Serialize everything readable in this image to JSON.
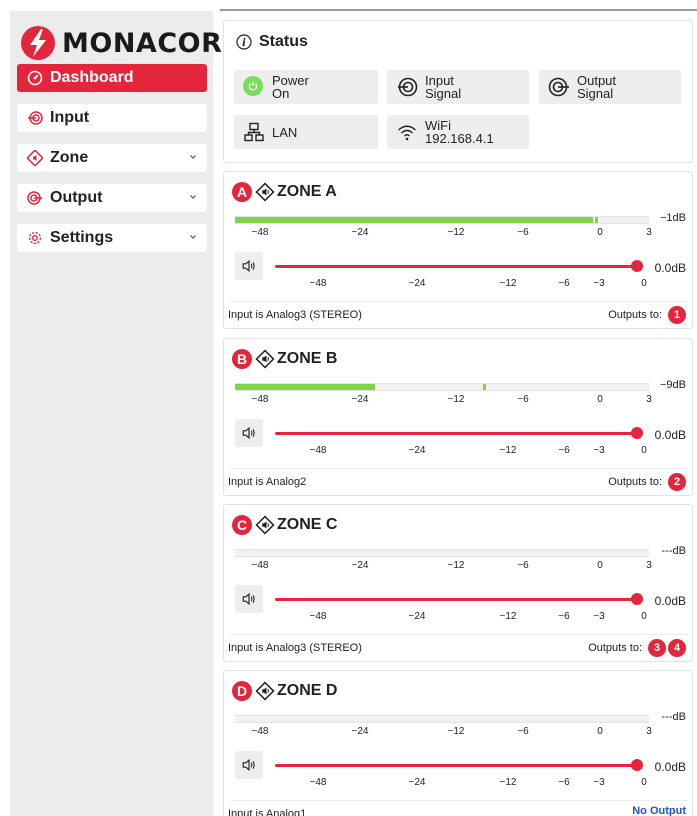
{
  "brand": {
    "name": "MONACOR",
    "accent": "#e3263b"
  },
  "top_partial_text": "",
  "nav": [
    {
      "label": "Dashboard",
      "icon": "dashboard-gauge-icon",
      "active": true,
      "has_chevron": false
    },
    {
      "label": "Input",
      "icon": "input-target-icon",
      "active": false,
      "has_chevron": false
    },
    {
      "label": "Zone",
      "icon": "zone-speaker-icon",
      "active": false,
      "has_chevron": true
    },
    {
      "label": "Output",
      "icon": "output-target-icon",
      "active": false,
      "has_chevron": true
    },
    {
      "label": "Settings",
      "icon": "gear-icon",
      "active": false,
      "has_chevron": true
    }
  ],
  "status": {
    "title": "Status",
    "tiles": [
      {
        "lines": [
          "Power",
          "On"
        ],
        "icon": "power-icon"
      },
      {
        "lines": [
          "Input",
          "Signal"
        ],
        "icon": "input-signal-icon"
      },
      {
        "lines": [
          "Output",
          "Signal"
        ],
        "icon": "output-signal-icon"
      },
      {
        "lines": [
          "LAN"
        ],
        "icon": "lan-icon"
      },
      {
        "lines": [
          "WiFi",
          "192.168.4.1"
        ],
        "icon": "wifi-icon"
      }
    ]
  },
  "meter_scale": [
    "−48",
    "−24",
    "−12",
    "−6",
    "0",
    "3"
  ],
  "volume_scale": [
    "−48",
    "−24",
    "−12",
    "−6",
    "−3",
    "0"
  ],
  "zones": [
    {
      "letter": "A",
      "title": "ZONE A",
      "meter_level": 0.95,
      "peak_level": 0.87,
      "meter_db": "−1dB",
      "volume_db": "0.0dB",
      "volume_level": 1.0,
      "input_text": "Input is Analog3 (STEREO)",
      "outputs_label": "Outputs to:",
      "outputs": [
        "1"
      ],
      "no_output_text": ""
    },
    {
      "letter": "B",
      "title": "ZONE B",
      "meter_level": 0.37,
      "peak_level": 0.6,
      "meter_db": "−9dB",
      "volume_db": "0.0dB",
      "volume_level": 1.0,
      "input_text": "Input is Analog2",
      "outputs_label": "Outputs to:",
      "outputs": [
        "2"
      ],
      "no_output_text": ""
    },
    {
      "letter": "C",
      "title": "ZONE C",
      "meter_level": 0,
      "peak_level": 0,
      "meter_db": "---dB",
      "volume_db": "0.0dB",
      "volume_level": 1.0,
      "input_text": "Input is Analog3 (STEREO)",
      "outputs_label": "Outputs to:",
      "outputs": [
        "3",
        "4"
      ],
      "no_output_text": ""
    },
    {
      "letter": "D",
      "title": "ZONE D",
      "meter_level": 0,
      "peak_level": 0,
      "meter_db": "---dB",
      "volume_db": "0.0dB",
      "volume_level": 1.0,
      "input_text": "Input is Analog1",
      "outputs_label": "",
      "outputs": [],
      "no_output_text": "No Output"
    }
  ]
}
